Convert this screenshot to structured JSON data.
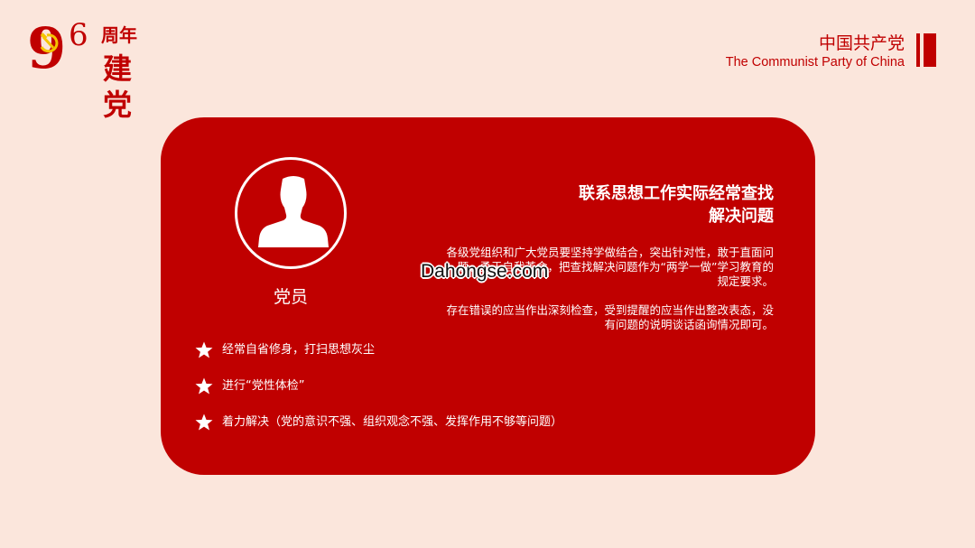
{
  "header": {
    "logo": {
      "big_digit": "9",
      "small_digit": "6",
      "anniversary": "周年",
      "founding": "建党"
    },
    "brand": {
      "chinese": "中国共产党",
      "english": "The Communist Party of China"
    }
  },
  "card": {
    "role_label": "党员",
    "avatar_icon": "person-silhouette-icon",
    "points": [
      {
        "icon": "star-icon",
        "text": "经常自省修身，打扫思想灰尘"
      },
      {
        "icon": "star-icon",
        "text": "进行“党性体检”"
      },
      {
        "icon": "star-icon",
        "text": "着力解决（党的意识不强、组织观念不强、发挥作用不够等问题）"
      }
    ],
    "heading_line1": "联系思想工作实际经常查找",
    "heading_line2": "解决问题",
    "paragraph1_line1": "各级党组织和广大党员要坚持学做结合，突出针对性，敢于直面问",
    "paragraph1_line2": "题、勇于自我革命，把查找解决问题作为“两学一做”学习教育的",
    "paragraph1_line3": "规定要求。",
    "paragraph2_line1": "存在错误的应当作出深刻检查，受到提醒的应当作出整改表态，没",
    "paragraph2_line2": "有问题的说明谈话函询情况即可。"
  },
  "watermark": "Dahongse.com",
  "colors": {
    "background": "#fbe6dc",
    "accent": "#c00000",
    "text_on_accent": "#ffffff"
  }
}
